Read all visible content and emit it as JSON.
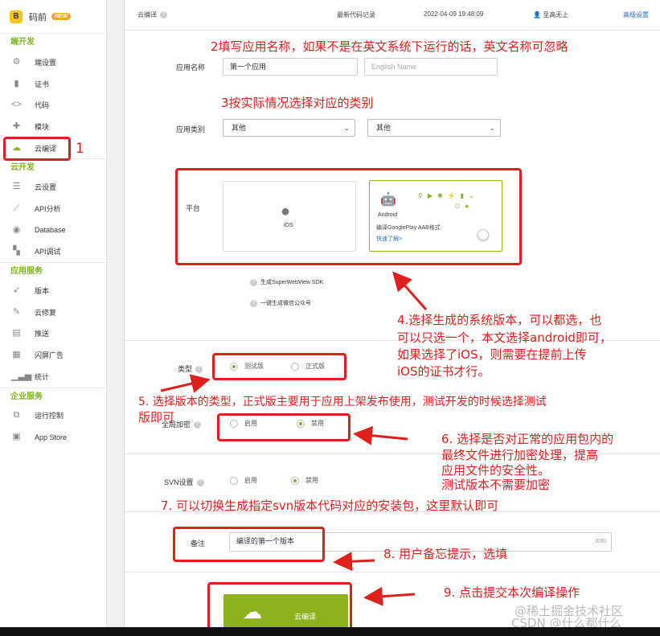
{
  "brand": {
    "logo": "B",
    "name": "码前",
    "badge": "NEW"
  },
  "sidebar": {
    "sections": [
      {
        "title": "端开发",
        "items": [
          {
            "label": "端设置",
            "icon": "gear-icon"
          },
          {
            "label": "证书",
            "icon": "file-icon"
          },
          {
            "label": "代码",
            "icon": "code-icon"
          },
          {
            "label": "模块",
            "icon": "puzzle-icon"
          },
          {
            "label": "云编译",
            "icon": "cloud-icon"
          }
        ]
      },
      {
        "title": "云开发",
        "items": [
          {
            "label": "云设置",
            "icon": "sliders-icon"
          },
          {
            "label": "API分析",
            "icon": "chart-icon"
          },
          {
            "label": "Database",
            "icon": "database-icon"
          },
          {
            "label": "API调试",
            "icon": "debug-icon"
          }
        ]
      },
      {
        "title": "应用服务",
        "items": [
          {
            "label": "版本",
            "icon": "rocket-icon"
          },
          {
            "label": "云修复",
            "icon": "wrench-icon"
          },
          {
            "label": "推送",
            "icon": "push-icon"
          },
          {
            "label": "闪屏广告",
            "icon": "billboard-icon"
          },
          {
            "label": "统计",
            "icon": "bars-icon"
          }
        ]
      },
      {
        "title": "企业服务",
        "items": [
          {
            "label": "运行控制",
            "icon": "control-icon"
          },
          {
            "label": "App Store",
            "icon": "store-icon"
          }
        ]
      }
    ]
  },
  "topbar": {
    "title": "云编译",
    "recent_label": "最新代码记录",
    "datetime": "2022-04-09 19:48:09",
    "user": "至高无上",
    "advanced": "高级设置"
  },
  "form": {
    "app_name_label": "应用名称",
    "app_name_value": "第一个应用",
    "english_name_placeholder": "English Name",
    "category_label": "应用类别",
    "category_1": "其他",
    "category_2": "其他",
    "platform_label": "平台",
    "ios_label": "iOS",
    "android_label": "Android",
    "android_desc": "编译GooglePlay AAB格式",
    "android_link": "快速了解>",
    "superwebview_hint": "生成SuperWebView SDK",
    "wechat_hint": "一键生成微信公众号",
    "type_label": "类型",
    "type_test": "测试版",
    "type_release": "正式版",
    "encrypt_label": "全局加密",
    "encrypt_on": "启用",
    "encrypt_off": "禁用",
    "svn_label": "SVN设置",
    "svn_on": "启用",
    "svn_off": "禁用",
    "remark_label": "备注",
    "remark_value": "编译的第一个版本",
    "remark_counter": "0/80",
    "compile_button": "云编译"
  },
  "annotations": {
    "n1": "1",
    "n2": "2填写应用名称，如果不是在英文系统下运行的话，英文名称可忽略",
    "n3": "3按实际情况选择对应的类别",
    "n4_l1": "4.选择生成的系统版本，可以都选，也",
    "n4_l2": "可以只选一个，本文选择android即可，",
    "n4_l3": "如果选择了iOS，则需要在提前上传",
    "n4_l4": "iOS的证书才行。",
    "n5_l1": "5. 选择版本的类型，正式版主要用于应用上架发布使用，测试开发的时候选择测试",
    "n5_l2": "版即可",
    "n6_l1": "6. 选择是否对正常的应用包内的",
    "n6_l2": "最终文件进行加密处理，提高",
    "n6_l3": "应用文件的安全性。",
    "n6_l4": "测试版本不需要加密",
    "n7": "7. 可以切换生成指定svn版本代码对应的安装包，这里默认即可",
    "n8": "8. 用户备忘提示，选填",
    "n9": "9. 点击提交本次编译操作"
  },
  "watermark": {
    "line1": "@稀土掘金技术社区",
    "line2": "CSDN @什么都什么"
  },
  "colors": {
    "accent": "#7ab51d",
    "annotation": "#e0201c",
    "button": "#8cb21e"
  }
}
